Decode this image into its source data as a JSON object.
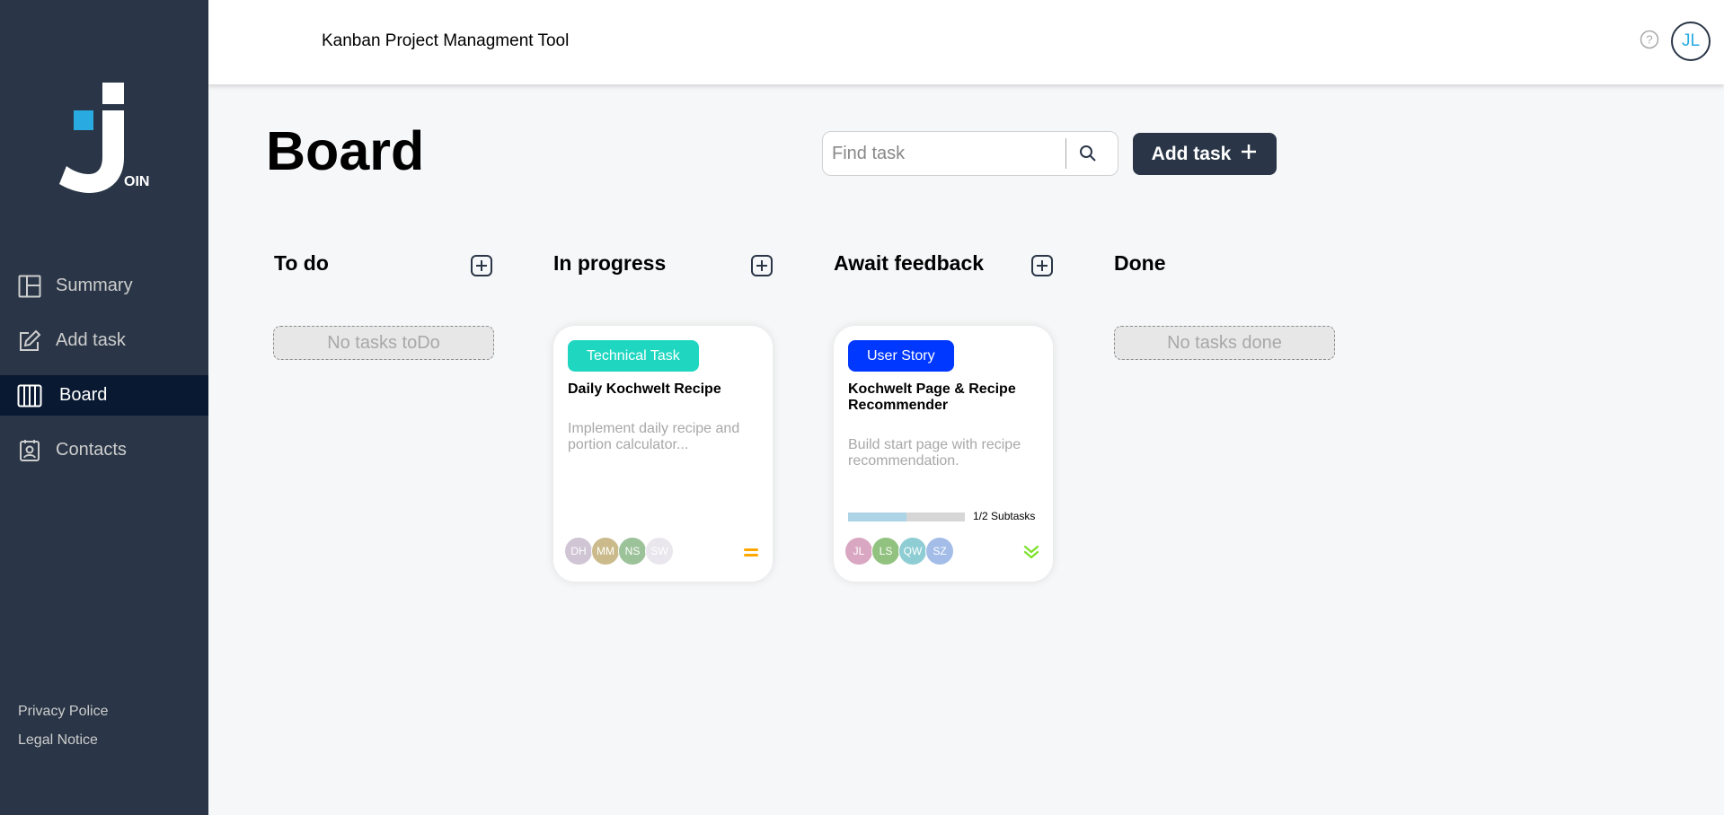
{
  "app": {
    "header_title": "Kanban Project Managment Tool",
    "user_initials": "JL",
    "logo_text": "OIN"
  },
  "sidebar": {
    "items": [
      {
        "label": "Summary",
        "icon": "summary-icon",
        "active": false
      },
      {
        "label": "Add task",
        "icon": "edit-icon",
        "active": false
      },
      {
        "label": "Board",
        "icon": "board-icon",
        "active": true
      },
      {
        "label": "Contacts",
        "icon": "contacts-icon",
        "active": false
      }
    ],
    "footer": {
      "privacy": "Privacy Police",
      "legal": "Legal Notice"
    }
  },
  "board": {
    "title": "Board",
    "search_placeholder": "Find task",
    "add_task_label": "Add task"
  },
  "columns": [
    {
      "title": "To do",
      "empty_text": "No tasks toDo"
    },
    {
      "title": "In progress"
    },
    {
      "title": "Await feedback"
    },
    {
      "title": "Done",
      "empty_text": "No tasks done"
    }
  ],
  "cards": [
    {
      "category": "Technical Task",
      "category_color": "#1fd7c1",
      "title": "Daily Kochwelt Recipe",
      "description": "Implement daily recipe and portion calculator...",
      "assignees": [
        {
          "initials": "DH",
          "color": "#cfc5d4"
        },
        {
          "initials": "MM",
          "color": "#cbbb8c"
        },
        {
          "initials": "NS",
          "color": "#9cc29a"
        },
        {
          "initials": "SW",
          "color": "#e9e6ed"
        }
      ],
      "priority": "medium",
      "priority_color": "#ffa800"
    },
    {
      "category": "User Story",
      "category_color": "#0038ff",
      "title": "Kochwelt Page & Recipe Recommender",
      "description": "Build start page with recipe recommendation.",
      "subtasks_done": 1,
      "subtasks_total": 2,
      "subtasks_label": "1/2 Subtasks",
      "assignees": [
        {
          "initials": "JL",
          "color": "#d9a7c1"
        },
        {
          "initials": "LS",
          "color": "#92c27f"
        },
        {
          "initials": "QW",
          "color": "#8ecdd4"
        },
        {
          "initials": "SZ",
          "color": "#a4bde8"
        }
      ],
      "priority": "low",
      "priority_color": "#7ae229"
    }
  ]
}
